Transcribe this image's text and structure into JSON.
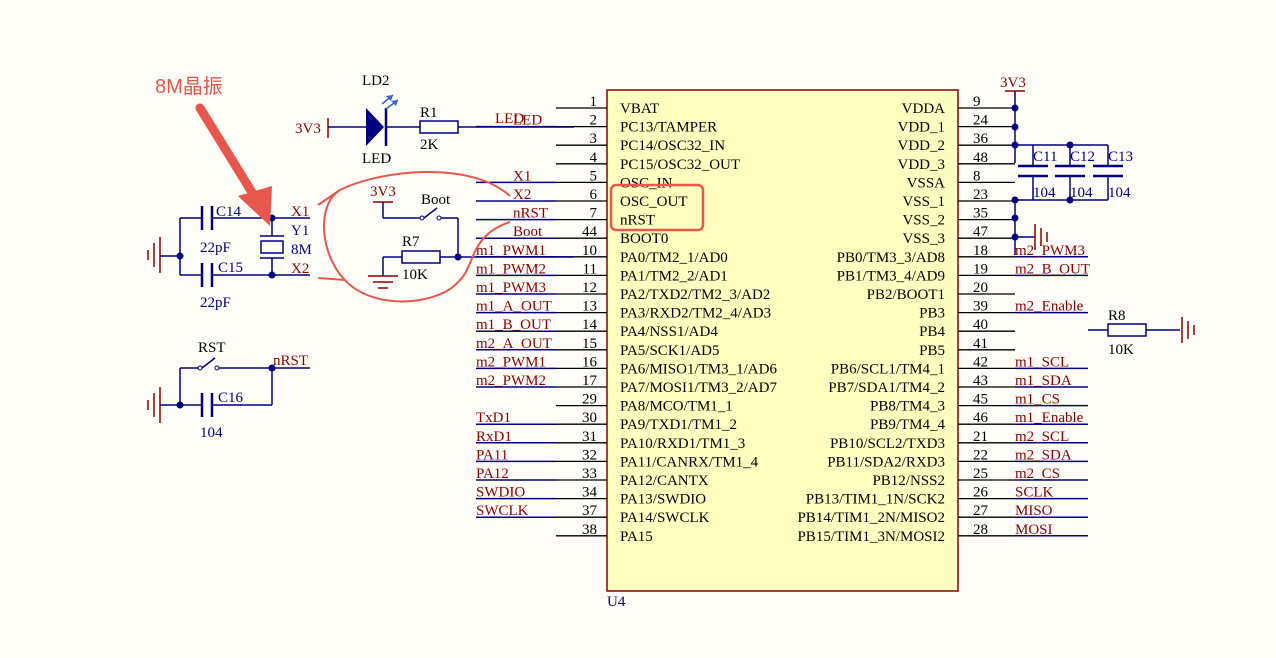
{
  "annotation": {
    "crystal_note": "8M晶振",
    "color": "#e8574c"
  },
  "colors": {
    "wire": "#000080",
    "label": "#8b0000",
    "ic_fill": "#ffffc0",
    "highlight": "#e8574c"
  },
  "mcu": {
    "designator": "U4",
    "left_pins": [
      {
        "num": "1",
        "name": "VBAT",
        "net": ""
      },
      {
        "num": "2",
        "name": "PC13/TAMPER",
        "net": "LED"
      },
      {
        "num": "3",
        "name": "PC14/OSC32_IN",
        "net": ""
      },
      {
        "num": "4",
        "name": "PC15/OSC32_OUT",
        "net": ""
      },
      {
        "num": "5",
        "name": "OSC_IN",
        "net": "X1"
      },
      {
        "num": "6",
        "name": "OSC_OUT",
        "net": "X2"
      },
      {
        "num": "7",
        "name": "nRST",
        "net": "nRST"
      },
      {
        "num": "44",
        "name": "BOOT0",
        "net": "Boot"
      },
      {
        "num": "10",
        "name": "PA0/TM2_1/AD0",
        "net": "m1_PWM1"
      },
      {
        "num": "11",
        "name": "PA1/TM2_2/AD1",
        "net": "m1_PWM2"
      },
      {
        "num": "12",
        "name": "PA2/TXD2/TM2_3/AD2",
        "net": "m1_PWM3"
      },
      {
        "num": "13",
        "name": "PA3/RXD2/TM2_4/AD3",
        "net": "m1_A_OUT"
      },
      {
        "num": "14",
        "name": "PA4/NSS1/AD4",
        "net": "m1_B_OUT"
      },
      {
        "num": "15",
        "name": "PA5/SCK1/AD5",
        "net": "m2_A_OUT"
      },
      {
        "num": "16",
        "name": "PA6/MISO1/TM3_1/AD6",
        "net": "m2_PWM1"
      },
      {
        "num": "17",
        "name": "PA7/MOSI1/TM3_2/AD7",
        "net": "m2_PWM2"
      },
      {
        "num": "29",
        "name": "PA8/MCO/TM1_1",
        "net": ""
      },
      {
        "num": "30",
        "name": "PA9/TXD1/TM1_2",
        "net": "TxD1"
      },
      {
        "num": "31",
        "name": "PA10/RXD1/TM1_3",
        "net": "RxD1"
      },
      {
        "num": "32",
        "name": "PA11/CANRX/TM1_4",
        "net": "PA11"
      },
      {
        "num": "33",
        "name": "PA12/CANTX",
        "net": "PA12"
      },
      {
        "num": "34",
        "name": "PA13/SWDIO",
        "net": "SWDIO"
      },
      {
        "num": "37",
        "name": "PA14/SWCLK",
        "net": "SWCLK"
      },
      {
        "num": "38",
        "name": "PA15",
        "net": ""
      }
    ],
    "right_pins": [
      {
        "num": "9",
        "name": "VDDA",
        "net": ""
      },
      {
        "num": "24",
        "name": "VDD_1",
        "net": ""
      },
      {
        "num": "36",
        "name": "VDD_2",
        "net": ""
      },
      {
        "num": "48",
        "name": "VDD_3",
        "net": ""
      },
      {
        "num": "8",
        "name": "VSSA",
        "net": ""
      },
      {
        "num": "23",
        "name": "VSS_1",
        "net": ""
      },
      {
        "num": "35",
        "name": "VSS_2",
        "net": ""
      },
      {
        "num": "47",
        "name": "VSS_3",
        "net": ""
      },
      {
        "num": "18",
        "name": "PB0/TM3_3/AD8",
        "net": "m2_PWM3"
      },
      {
        "num": "19",
        "name": "PB1/TM3_4/AD9",
        "net": "m2_B_OUT"
      },
      {
        "num": "20",
        "name": "PB2/BOOT1",
        "net": ""
      },
      {
        "num": "39",
        "name": "PB3",
        "net": "m2_Enable"
      },
      {
        "num": "40",
        "name": "PB4",
        "net": ""
      },
      {
        "num": "41",
        "name": "PB5",
        "net": ""
      },
      {
        "num": "42",
        "name": "PB6/SCL1/TM4_1",
        "net": "m1_SCL"
      },
      {
        "num": "43",
        "name": "PB7/SDA1/TM4_2",
        "net": "m1_SDA"
      },
      {
        "num": "45",
        "name": "PB8/TM4_3",
        "net": "m1_CS"
      },
      {
        "num": "46",
        "name": "PB9/TM4_4",
        "net": "m1_Enable"
      },
      {
        "num": "21",
        "name": "PB10/SCL2/TXD3",
        "net": "m2_SCL"
      },
      {
        "num": "22",
        "name": "PB11/SDA2/RXD3",
        "net": "m2_SDA"
      },
      {
        "num": "25",
        "name": "PB12/NSS2",
        "net": "m2_CS"
      },
      {
        "num": "26",
        "name": "PB13/TIM1_1N/SCK2",
        "net": "SCLK"
      },
      {
        "num": "27",
        "name": "PB14/TIM1_2N/MISO2",
        "net": "MISO"
      },
      {
        "num": "28",
        "name": "PB15/TIM1_3N/MOSI2",
        "net": "MOSI"
      }
    ]
  },
  "power": {
    "rail_top": "3V3",
    "rail_led": "3V3",
    "rail_boot": "3V3"
  },
  "decoupling": [
    {
      "ref": "C11",
      "value": "104"
    },
    {
      "ref": "C12",
      "value": "104"
    },
    {
      "ref": "C13",
      "value": "104"
    }
  ],
  "led": {
    "ref": "LD2",
    "type": "LED",
    "resistor_ref": "R1",
    "resistor_value": "2K",
    "net": "LED"
  },
  "crystal": {
    "ref": "Y1",
    "value": "8M",
    "cap1_ref": "C14",
    "cap1_value": "22pF",
    "cap2_ref": "C15",
    "cap2_value": "22pF",
    "net1": "X1",
    "net2": "X2"
  },
  "boot": {
    "switch": "Boot",
    "resistor_ref": "R7",
    "resistor_value": "10K"
  },
  "r8": {
    "ref": "R8",
    "value": "10K"
  },
  "reset": {
    "switch": "RST",
    "cap_ref": "C16",
    "cap_value": "104",
    "net": "nRST"
  }
}
